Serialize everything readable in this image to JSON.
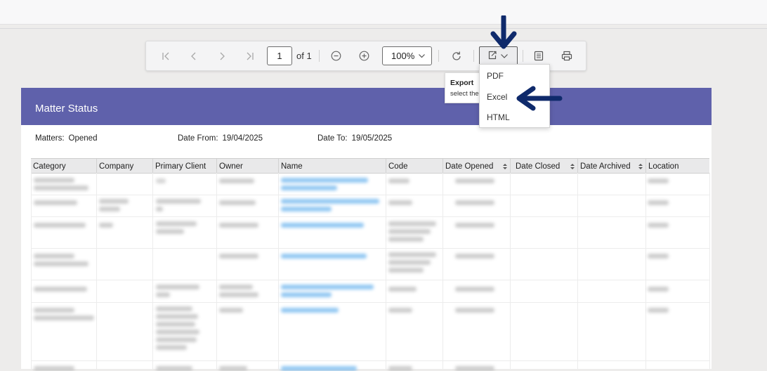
{
  "toolbar": {
    "page_current": "1",
    "page_total_label": "of 1",
    "zoom_value": "100%",
    "icons": [
      "first-page-icon",
      "prev-page-icon",
      "next-page-icon",
      "last-page-icon",
      "zoom-out-icon",
      "zoom-in-icon",
      "refresh-icon",
      "export-icon",
      "document-icon",
      "print-icon"
    ]
  },
  "export_tooltip": {
    "title": "Export",
    "body": "select the export format"
  },
  "export_menu": {
    "items": [
      "PDF",
      "Excel",
      "HTML"
    ]
  },
  "report": {
    "title": "Matter Status",
    "header_color": "#5f61ab",
    "params": {
      "matters_label": "Matters:",
      "matters_value": "Opened",
      "date_from_label": "Date From:",
      "date_from_value": "19/04/2025",
      "date_to_label": "Date To:",
      "date_to_value": "19/05/2025"
    },
    "columns": [
      "Category",
      "Company",
      "Primary Client",
      "Owner",
      "Name",
      "Code",
      "Date Opened",
      "Date Closed",
      "Date Archived",
      "Location"
    ]
  },
  "annotation_color": "#0f2a6b"
}
